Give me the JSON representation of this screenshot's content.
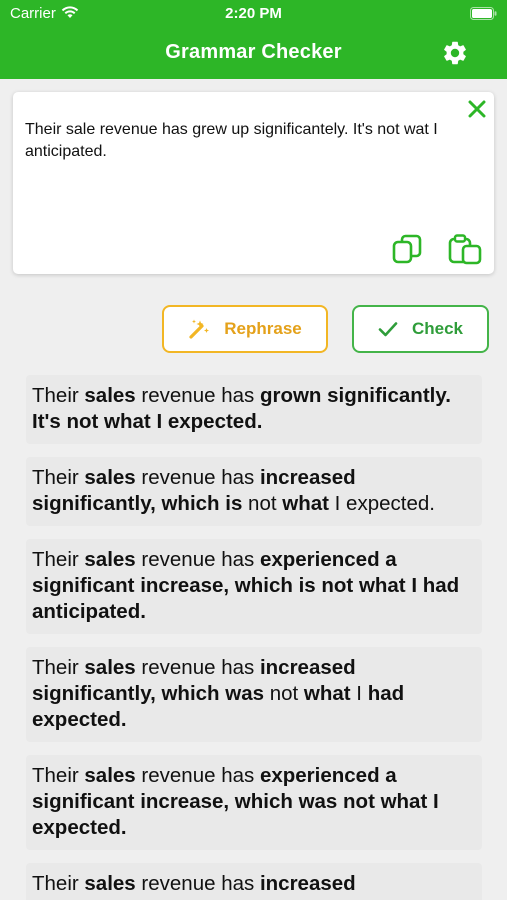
{
  "status_bar": {
    "carrier": "Carrier",
    "time": "2:20 PM"
  },
  "header": {
    "title": "Grammar Checker",
    "settings_icon": "gear-icon"
  },
  "input": {
    "text": "Their sale revenue has grew up significantely. It's not wat I anticipated.",
    "clear_icon": "close-icon",
    "copy_icon": "copy-icon",
    "paste_icon": "paste-icon"
  },
  "actions": {
    "rephrase_label": "Rephrase",
    "check_label": "Check"
  },
  "colors": {
    "brand_green": "#2db627",
    "rephrase_accent": "#f2b624",
    "check_accent": "#44b449"
  },
  "suggestions": [
    [
      [
        "Their ",
        false
      ],
      [
        "sales",
        true
      ],
      [
        " revenue has ",
        false
      ],
      [
        "grown significantly. It's not what I expected.",
        true
      ]
    ],
    [
      [
        "Their ",
        false
      ],
      [
        "sales",
        true
      ],
      [
        " revenue has ",
        false
      ],
      [
        "increased significantly, which is",
        true
      ],
      [
        " not ",
        false
      ],
      [
        "what",
        true
      ],
      [
        " I expected.",
        false
      ]
    ],
    [
      [
        "Their ",
        false
      ],
      [
        "sales",
        true
      ],
      [
        " revenue has ",
        false
      ],
      [
        "experienced a significant increase, which is not what I had anticipated.",
        true
      ]
    ],
    [
      [
        "Their ",
        false
      ],
      [
        "sales",
        true
      ],
      [
        " revenue has ",
        false
      ],
      [
        "increased significantly, which was",
        true
      ],
      [
        " not ",
        false
      ],
      [
        "what",
        true
      ],
      [
        " I ",
        false
      ],
      [
        "had expected.",
        true
      ]
    ],
    [
      [
        "Their ",
        false
      ],
      [
        "sales",
        true
      ],
      [
        " revenue has ",
        false
      ],
      [
        "experienced a significant increase, which was not what I expected.",
        true
      ]
    ],
    [
      [
        "Their ",
        false
      ],
      [
        "sales",
        true
      ],
      [
        " revenue has ",
        false
      ],
      [
        "increased",
        true
      ]
    ]
  ]
}
